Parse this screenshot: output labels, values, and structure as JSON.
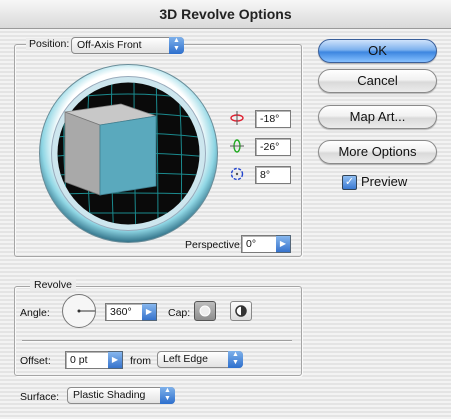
{
  "window": {
    "title": "3D Revolve Options"
  },
  "position": {
    "label": "Position:",
    "selected": "Off-Axis Front",
    "rotation_x": "-18°",
    "rotation_y": "-26°",
    "rotation_z": "8°",
    "perspective_label": "Perspective:",
    "perspective_value": "0°"
  },
  "buttons": {
    "ok": "OK",
    "cancel": "Cancel",
    "map_art": "Map Art...",
    "more_options": "More Options"
  },
  "preview": {
    "label": "Preview",
    "checked": true
  },
  "revolve": {
    "group_label": "Revolve",
    "angle_label": "Angle:",
    "angle_value": "360°",
    "cap_label": "Cap:",
    "offset_label": "Offset:",
    "offset_value": "0 pt",
    "from_label": "from",
    "from_selected": "Left Edge"
  },
  "surface": {
    "label": "Surface:",
    "selected": "Plastic Shading"
  },
  "colors": {
    "accent": "#3d86e0",
    "cube_face": "#5aa9bd"
  }
}
